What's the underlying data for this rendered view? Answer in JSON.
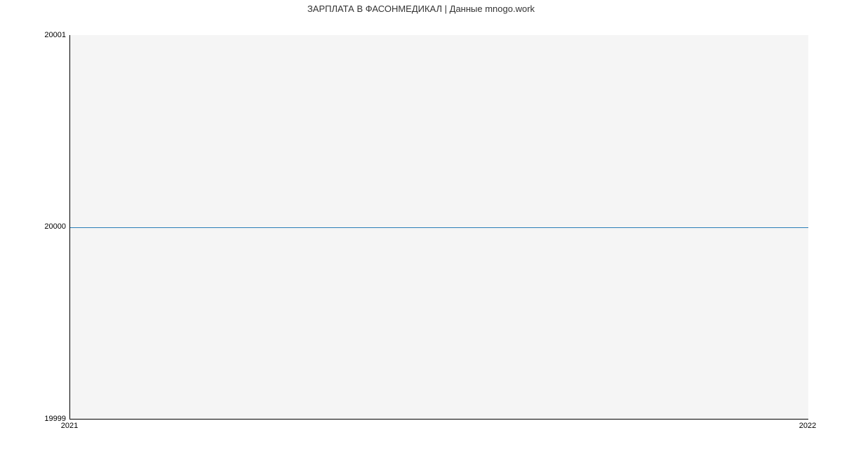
{
  "chart_data": {
    "type": "line",
    "title": "ЗАРПЛАТА В ФАСОНМЕДИКАЛ | Данные mnogo.work",
    "xlabel": "",
    "ylabel": "",
    "x": [
      2021,
      2022
    ],
    "values": [
      20000,
      20000
    ],
    "ylim": [
      19999,
      20001
    ],
    "y_ticks": [
      19999,
      20000,
      20001
    ],
    "x_ticks": [
      2021,
      2022
    ],
    "series_color": "#1f77b4",
    "plot_bg": "#f5f5f5"
  }
}
